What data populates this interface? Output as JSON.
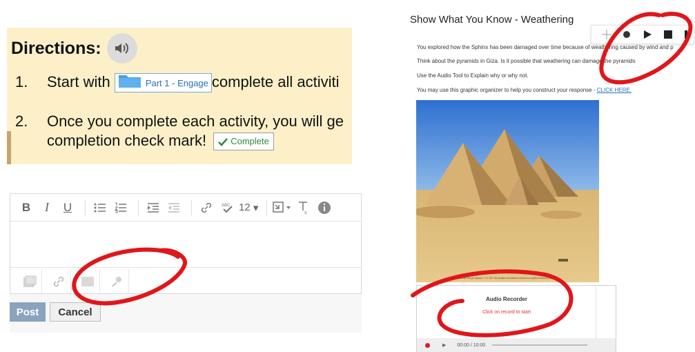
{
  "directions": {
    "title": "Directions:",
    "step1_num": "1.",
    "step1_pre": "Start with",
    "step1_badge": "Part 1 - Engage",
    "step1_post": "complete all activiti",
    "step2_num": "2.",
    "step2_line1": "Once you complete each activity, you will ge",
    "step2_line2": "completion check mark!",
    "complete_badge": "Complete"
  },
  "editor": {
    "bold": "B",
    "italic": "I",
    "underline": "U",
    "font_size": "12",
    "post_label": "Post",
    "cancel_label": "Cancel"
  },
  "assignment": {
    "title": "Show What You Know - Weathering",
    "line1": "You explored how the Sphinx has been damaged over time because of weathering caused by wind and p",
    "line2": "Think about the pyramids in Giza. Is it possible that weathering can damage the pyramids",
    "line3": "Use the Audio Tool to Explain why or why not.",
    "line4_pre": "You may use this graphic organizer to help you construct your response - ",
    "line4_link": "CLICK HERE.",
    "photo_credit": "Marhal Nerjal Nyaso / CC BY-SA (https://creativecommons.org/licenses/by-sa/3.0)"
  },
  "recorder": {
    "title": "Audio Recorder",
    "hint": "Click on record to start",
    "time": "00:00 / 10:00"
  },
  "colors": {
    "directions_bg": "#fdf0c8",
    "annotation_red": "#e0161b",
    "post_button": "#8aa3bf",
    "link_blue": "#2a6fb8"
  },
  "icons": {
    "audio": "speaker-icon",
    "folder": "folder-icon",
    "check": "check-icon",
    "move": "move-icon",
    "record": "record-icon",
    "play": "play-icon",
    "stop": "stop-icon",
    "pause": "pause-icon",
    "mic": "microphone-icon"
  }
}
